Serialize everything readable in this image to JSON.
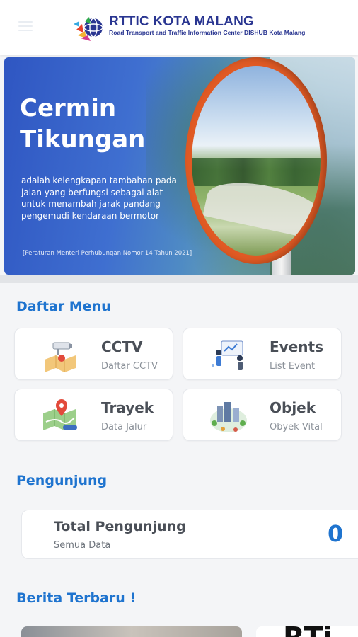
{
  "header": {
    "title": "RTTIC KOTA MALANG",
    "subtitle": "Road Transport and Traffic Information Center DISHUB Kota Malang",
    "menu_icon": "hamburger-icon",
    "logo_icon": "rttic-logo-icon"
  },
  "banner": {
    "title_line1": "Cermin",
    "title_line2": "Tikungan",
    "description": "adalah kelengkapan tambahan pada jalan yang berfungsi sebagai alat untuk menambah jarak pandang pengemudi kendaraan bermotor",
    "reference": "[Peraturan Menteri Perhubungan Nomor 14 Tahun 2021]"
  },
  "menu": {
    "title": "Daftar Menu",
    "items": [
      {
        "label": "CCTV",
        "sub": "Daftar CCTV",
        "icon": "cctv-map-icon"
      },
      {
        "label": "Events",
        "sub": "List Event",
        "icon": "events-people-icon"
      },
      {
        "label": "Trayek",
        "sub": "Data Jalur",
        "icon": "route-map-icon"
      },
      {
        "label": "Objek",
        "sub": "Obyek Vital",
        "icon": "city-object-icon"
      }
    ]
  },
  "visitors": {
    "title": "Pengunjung",
    "card_title": "Total Pengunjung",
    "card_sub": "Semua Data",
    "count": "0"
  },
  "news": {
    "title": "Berita Terbaru !",
    "thumb2_text": "RTi"
  },
  "colors": {
    "accent": "#1f74cf",
    "brand": "#2a3691",
    "banner_blue": "#2f56c2",
    "mirror_orange": "#e05a24"
  }
}
